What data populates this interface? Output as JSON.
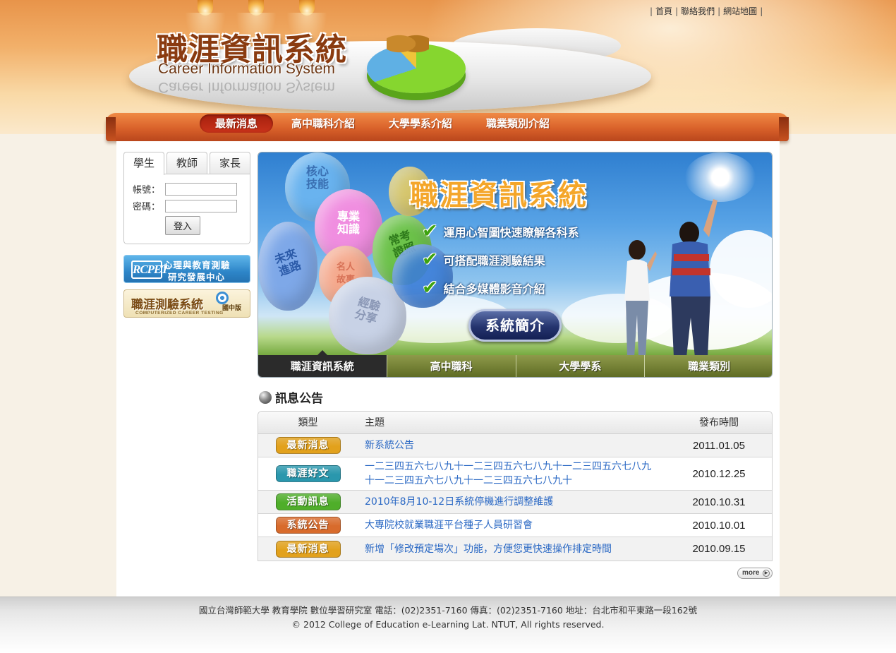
{
  "header": {
    "logo_title": "職涯資訊系統",
    "logo_subtitle": "Career Information System",
    "top_links": [
      "首頁",
      "聯絡我們",
      "網站地圖"
    ]
  },
  "nav": {
    "items": [
      {
        "label": "最新消息",
        "active": true
      },
      {
        "label": "高中職科介紹",
        "active": false
      },
      {
        "label": "大學學系介紹",
        "active": false
      },
      {
        "label": "職業類別介紹",
        "active": false
      }
    ]
  },
  "login": {
    "tabs": [
      {
        "label": "學生",
        "active": true
      },
      {
        "label": "教師",
        "active": false
      },
      {
        "label": "家長",
        "active": false
      }
    ],
    "account_label": "帳號：",
    "password_label": "密碼：",
    "account_value": "",
    "password_value": "",
    "submit_label": "登入"
  },
  "side_banners": {
    "psych": {
      "emblem": "RCPET",
      "line1": "心理與教育測驗",
      "line2": "研究發展中心"
    },
    "career": {
      "title": "職涯測驗系統",
      "subtitle": "COMPUTERIZED CAREER TESTING",
      "edition": "國中版"
    }
  },
  "hero": {
    "title": "職涯資訊系統",
    "checks": [
      "運用心智圖快速瞭解各科系",
      "可搭配職涯測驗結果",
      "結合多媒體影音介紹"
    ],
    "intro_button": "系統簡介",
    "balloons": [
      "核心技能",
      "專業知識",
      "常考證照",
      "未來進路",
      "名人故事",
      "經驗分享"
    ],
    "tabs": [
      {
        "label": "職涯資訊系統",
        "active": true
      },
      {
        "label": "高中職科",
        "active": false
      },
      {
        "label": "大學學系",
        "active": false
      },
      {
        "label": "職業類別",
        "active": false
      }
    ]
  },
  "announcements": {
    "section_title": "訊息公告",
    "headers": {
      "type": "類型",
      "subject": "主題",
      "date": "發布時間"
    },
    "rows": [
      {
        "type": "最新消息",
        "type_color": "#e2a11c",
        "subject": "新系統公告",
        "date": "2011.01.05"
      },
      {
        "type": "職涯好文",
        "type_color": "#2a97ad",
        "subject": "一二三四五六七八九十一二三四五六七八九十一二三四五六七八九十一二三四五六七八九十一二三四五六七八九十",
        "date": "2010.12.25"
      },
      {
        "type": "活動訊息",
        "type_color": "#4fae2a",
        "subject": "2010年8月10-12日系統停機進行調整維護",
        "date": "2010.10.31"
      },
      {
        "type": "系統公告",
        "type_color": "#d86b2c",
        "subject": "大專院校就業職涯平台種子人員研習會",
        "date": "2010.10.01"
      },
      {
        "type": "最新消息",
        "type_color": "#e2a11c",
        "subject": "新增「修改預定場次」功能，方便您更快速操作排定時間",
        "date": "2010.09.15"
      }
    ],
    "more_label": "more"
  },
  "footer": {
    "line1": "國立台灣師範大學 教育學院 數位學習研究室 電話：(02)2351-7160 傳真：(02)2351-7160 地址：台北市和平東路一段162號",
    "line2": "© 2012 College of Education e-Learning Lat. NTUT, All rights reserved."
  }
}
